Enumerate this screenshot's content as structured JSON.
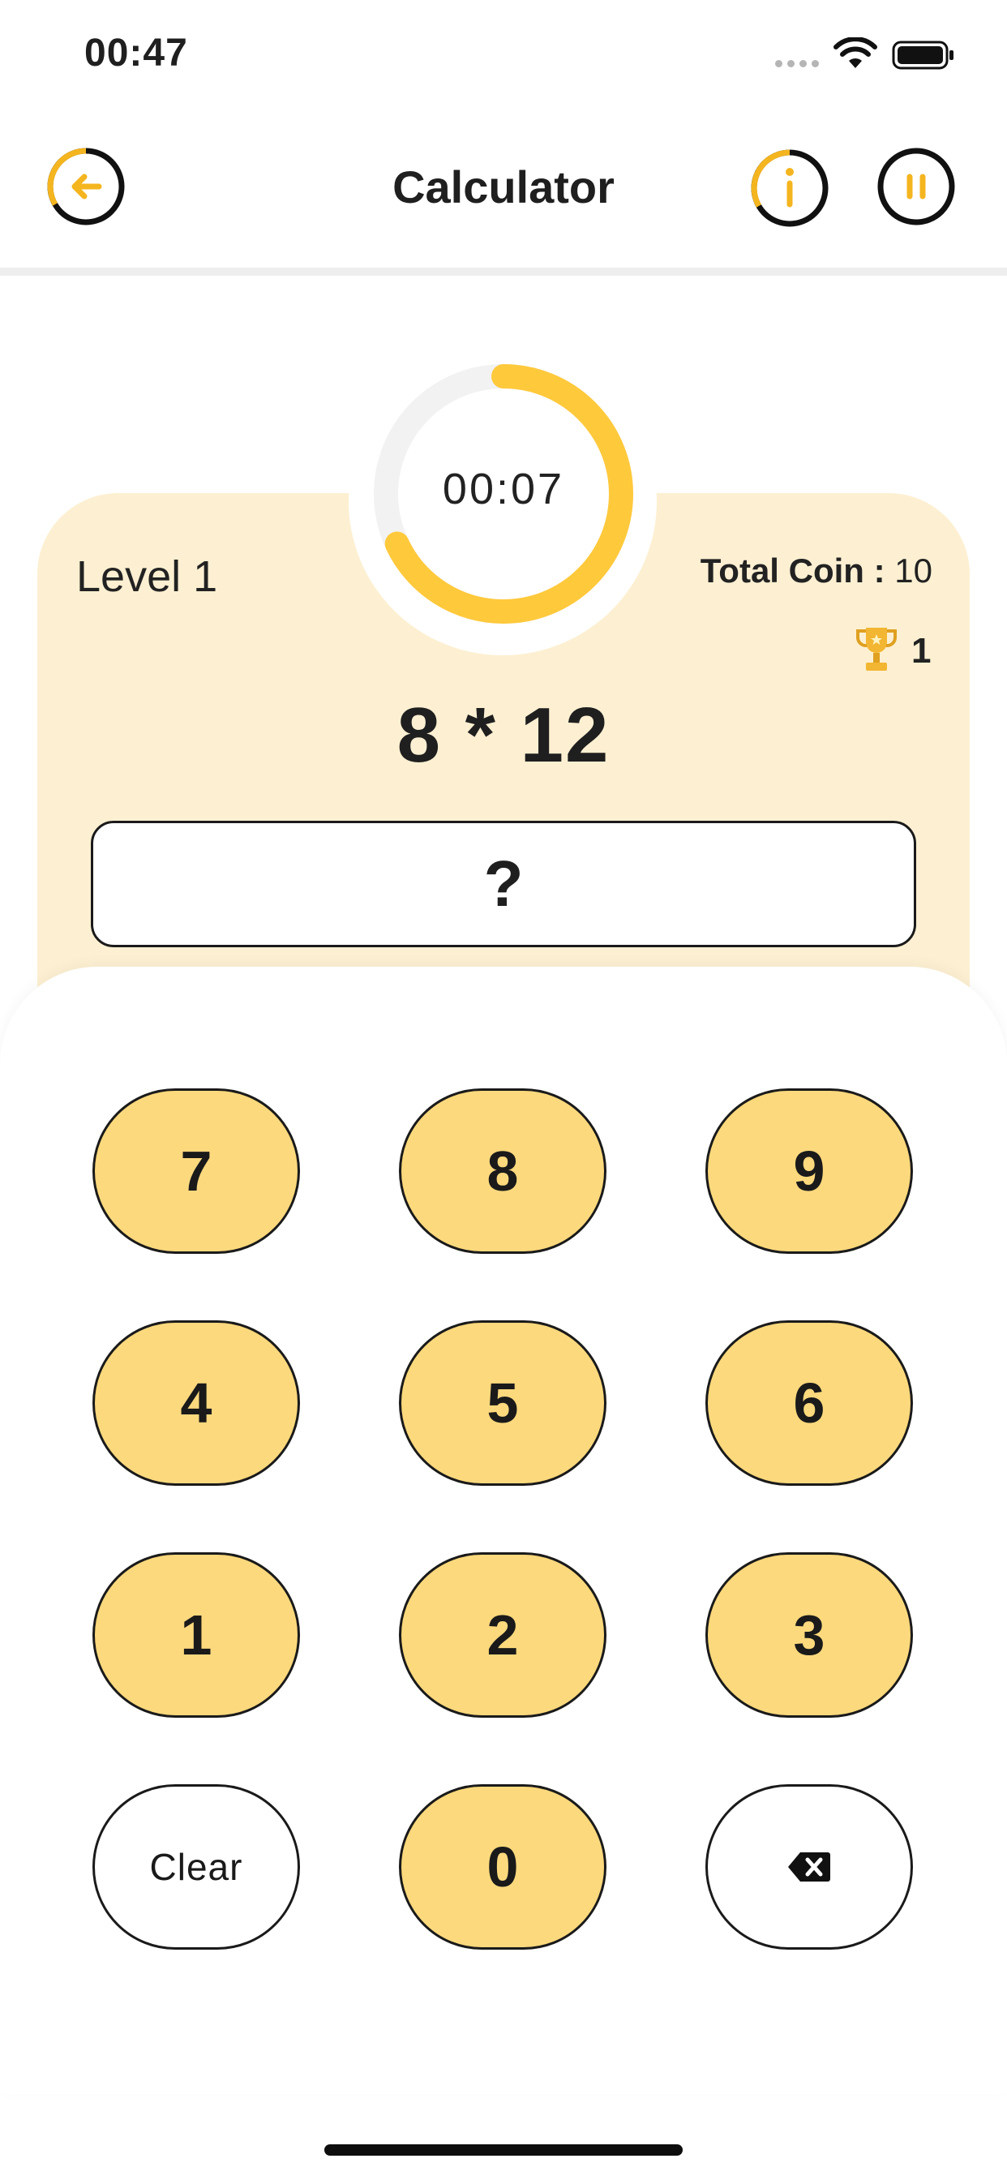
{
  "status_bar": {
    "time": "00:47"
  },
  "header": {
    "title": "Calculator"
  },
  "game": {
    "timer": "00:07",
    "timer_progress": 0.68,
    "level": "Level 1",
    "total_coin_label": "Total Coin : ",
    "total_coin_value": "10",
    "trophies": "1",
    "question": "8 * 12",
    "answer_placeholder": "?"
  },
  "keypad": {
    "k7": "7",
    "k8": "8",
    "k9": "9",
    "k4": "4",
    "k5": "5",
    "k6": "6",
    "k1": "1",
    "k2": "2",
    "k3": "3",
    "clear": "Clear",
    "k0": "0"
  },
  "icons": {
    "back": "arrow-left-icon",
    "info": "info-icon",
    "pause": "pause-icon",
    "trophy": "trophy-icon",
    "backspace": "backspace-icon"
  },
  "colors": {
    "accent": "#f4b51f",
    "ring": "#ffc93c",
    "card": "#fdf0d2",
    "key": "#fcd97d"
  }
}
